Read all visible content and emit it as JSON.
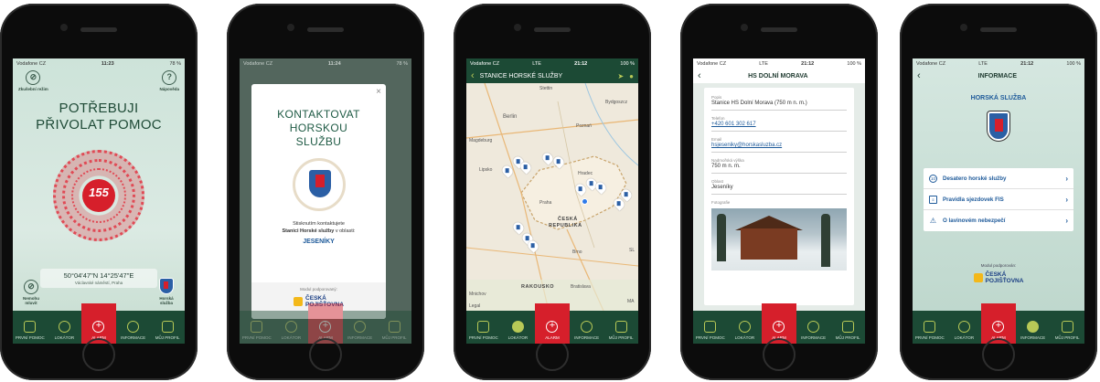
{
  "tabs": [
    "PRVNÍ POMOC",
    "LOKÁTOR",
    "ALARM",
    "INFORMACE",
    "MŮJ PROFIL"
  ],
  "screen1": {
    "status": {
      "carrier": "Vodafone CZ",
      "time": "11:23",
      "battery": "78 %"
    },
    "test_mode": "Zkušební režim",
    "help": "Nápověda",
    "help_glyph": "?",
    "title_line1": "POTŘEBUJI",
    "title_line2": "PŘIVOLAT POMOC",
    "emergency_number": "155",
    "gps_coords": "50°04'47\"N 14°25'47\"E",
    "gps_place": "Václavské náměstí, Praha",
    "cannot_speak": "Nemohu mluvit",
    "mountain_service": "Horská služba"
  },
  "screen2": {
    "status": {
      "carrier": "Vodafone CZ",
      "time": "11:24",
      "battery": "78 %"
    },
    "close": "×",
    "title_line1": "KONTAKTOVAT",
    "title_line2": "HORSKOU",
    "title_line3": "SLUŽBU",
    "text1": "Stisknutím kontaktujete",
    "text2": "Stanici Horské služby",
    "text3": "v oblasti:",
    "area": "JESENÍKY",
    "sponsor_label": "Modul podporovaný:",
    "sponsor_name1": "ČESKÁ",
    "sponsor_name2": "POJIŠŤOVNA"
  },
  "screen3": {
    "status": {
      "carrier": "Vodafone CZ",
      "network": "LTE",
      "time": "21:12",
      "battery": "100 %"
    },
    "back": "‹",
    "title": "STANICE HORSKÉ SLUŽBY",
    "map_labels": [
      "Stettin",
      "Bydgoszcz",
      "Berlin",
      "Poznań",
      "Magdeburg",
      "Lipsko",
      "Hradec",
      "Praha",
      "ČESKÁ",
      "REPUBLIKA",
      "Brno",
      "Mnichov",
      "Bratislava",
      "RAKOUSKO",
      "Legal",
      "MA",
      "SL"
    ]
  },
  "screen4": {
    "status": {
      "carrier": "Vodafone CZ",
      "network": "LTE",
      "time": "21:12",
      "battery": "100 %"
    },
    "back": "‹",
    "title": "HS DOLNÍ MORAVA",
    "fields": [
      {
        "key": "Popis",
        "value": "Stanice HS Dolní Morava (750 m n. m.)",
        "link": false
      },
      {
        "key": "Telefon",
        "value": "+420 601 302 617",
        "link": true
      },
      {
        "key": "Email",
        "value": "hsjeseniky@horskasluzba.cz",
        "link": true
      },
      {
        "key": "Nadmořská výška",
        "value": "750 m n. m.",
        "link": false
      },
      {
        "key": "Oblast",
        "value": "Jeseníky",
        "link": false
      }
    ],
    "photo_label": "Fotografie"
  },
  "screen5": {
    "status": {
      "carrier": "Vodafone CZ",
      "network": "LTE",
      "time": "21:12",
      "battery": "100 %"
    },
    "back": "‹",
    "title": "INFORMACE",
    "section_title": "HORSKÁ SLUŽBA",
    "menu": [
      {
        "icon": "10",
        "label": "Desatero horské služby",
        "chev": "›"
      },
      {
        "icon": "≡",
        "label": "Pravidla sjezdovek FIS",
        "chev": "›"
      },
      {
        "icon": "⚠",
        "label": "O lavinovém nebezpečí",
        "chev": "›"
      }
    ],
    "sponsor_label": "Modul podporován:",
    "sponsor_name1": "ČESKÁ",
    "sponsor_name2": "POJIŠŤOVNA"
  }
}
